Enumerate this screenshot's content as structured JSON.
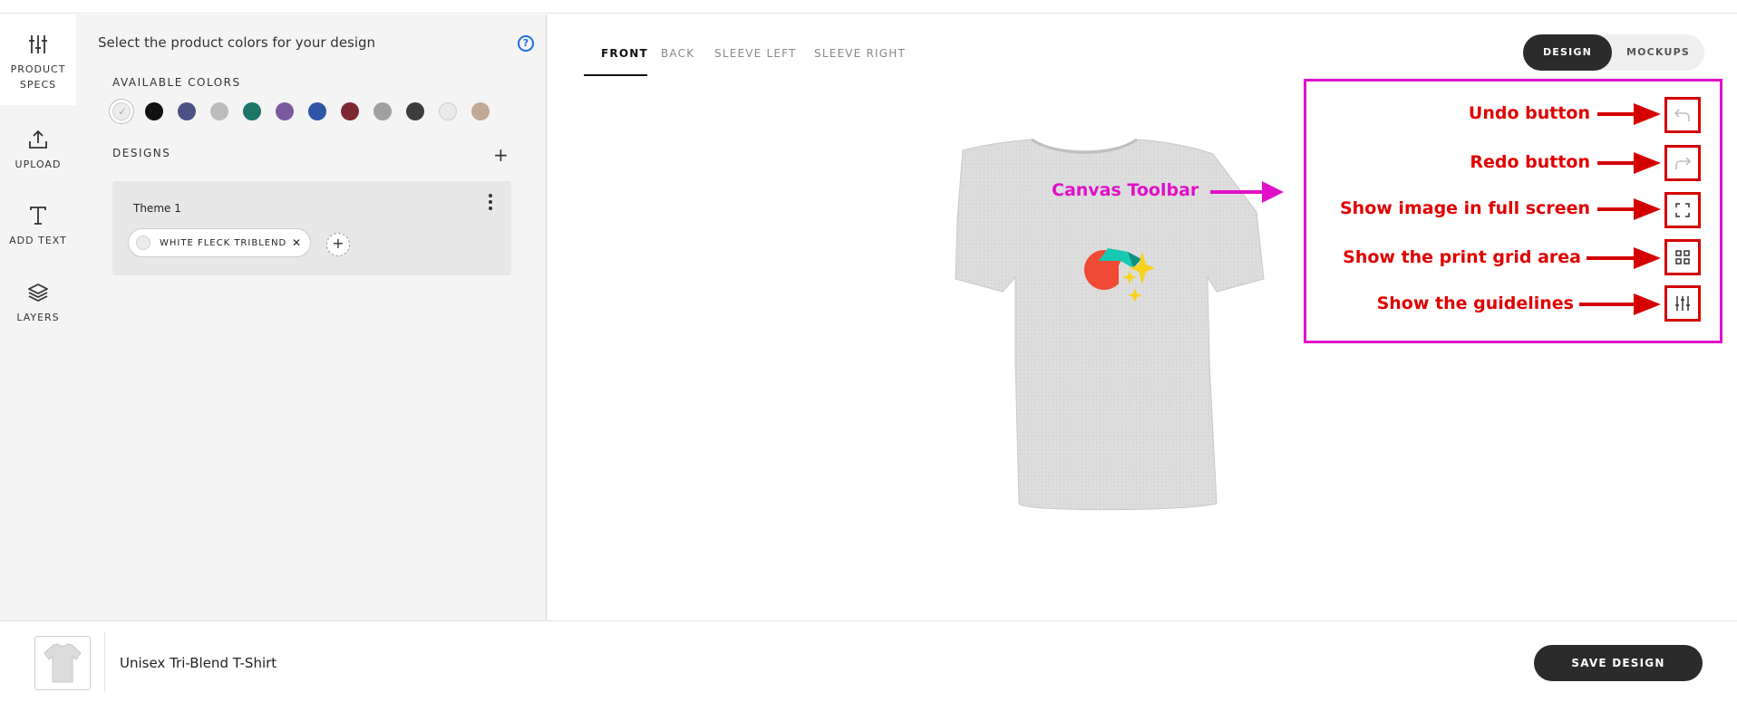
{
  "rail": {
    "items": [
      {
        "label_line1": "PRODUCT",
        "label_line2": "SPECS",
        "icon": "sliders-icon"
      },
      {
        "label": "UPLOAD",
        "icon": "upload-icon"
      },
      {
        "label": "ADD TEXT",
        "icon": "text-icon"
      },
      {
        "label": "LAYERS",
        "icon": "layers-icon"
      }
    ]
  },
  "panel": {
    "title": "Select the product colors for your design",
    "help_icon_glyph": "?",
    "available_colors_label": "AVAILABLE COLORS",
    "colors": [
      "#ececec",
      "#111111",
      "#4e5284",
      "#bcbcbc",
      "#1f7468",
      "#7b5a9f",
      "#2f56a6",
      "#7e2733",
      "#a0a0a0",
      "#3d3d3d",
      "#e9e9eb",
      "#c2a994"
    ],
    "designs_label": "DESIGNS",
    "add_design_glyph": "+",
    "design_card": {
      "theme_name": "Theme 1",
      "chip_label": "WHITE FLECK TRIBLEND",
      "chip_remove_glyph": "✕",
      "chip_add_glyph": "+"
    }
  },
  "tabs": [
    "FRONT",
    "BACK",
    "SLEEVE LEFT",
    "SLEEVE RIGHT"
  ],
  "view_toggle": {
    "design": "DESIGN",
    "mockups": "MOCKUPS"
  },
  "annotations": {
    "canvas_toolbar": "Canvas Toolbar",
    "undo": "Undo button",
    "redo": "Redo button",
    "fullscreen": "Show image in full screen",
    "print_grid": "Show the print grid area",
    "guidelines": "Show the guidelines"
  },
  "colors": {
    "accent_dark": "#2b2b2b",
    "annotation_red": "#e00000",
    "annotation_magenta": "#e010c8",
    "help_blue": "#1e6fe0"
  },
  "bottom": {
    "product_name": "Unisex Tri-Blend T-Shirt",
    "save_label": "SAVE DESIGN"
  }
}
